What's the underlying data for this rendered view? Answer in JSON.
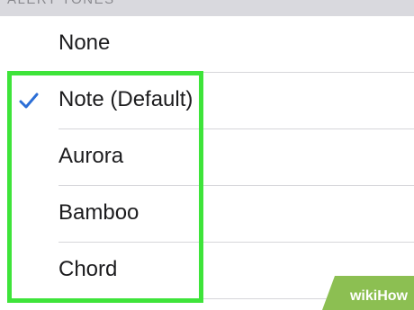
{
  "section_header": "ALERT TONES",
  "tones": [
    {
      "label": "None",
      "selected": false
    },
    {
      "label": "Note (Default)",
      "selected": true
    },
    {
      "label": "Aurora",
      "selected": false
    },
    {
      "label": "Bamboo",
      "selected": false
    },
    {
      "label": "Chord",
      "selected": false
    }
  ],
  "check_icon": "checkmark-icon",
  "colors": {
    "accent": "#2b6ed6",
    "highlight": "#3ee43a",
    "watermark": "#8cbf52"
  },
  "watermark": {
    "text": "wikiHow"
  }
}
